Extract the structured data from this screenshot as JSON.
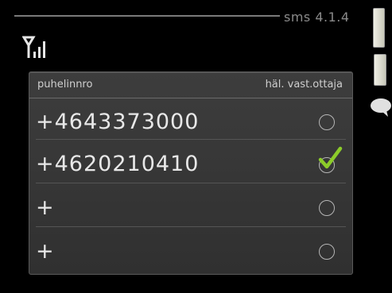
{
  "header": {
    "screen_id": "sms 4.1.4"
  },
  "table": {
    "col_phone": "puhelinnro",
    "col_receiver": "häl. vast.ottaja",
    "rows": [
      {
        "number": "+4643373000",
        "checked": false
      },
      {
        "number": "+4620210410",
        "checked": true
      },
      {
        "number": "+",
        "checked": false
      },
      {
        "number": "+",
        "checked": false
      }
    ]
  },
  "icons": {
    "signal": "signal-strength-icon",
    "checkmark": "checkmark-icon",
    "chat": "chat-bubble-icon",
    "slider": "slider-icon",
    "thermometer": "thermometer-icon"
  },
  "colors": {
    "check": "#8ccc2a",
    "background": "#000000",
    "panel": "#383838"
  }
}
